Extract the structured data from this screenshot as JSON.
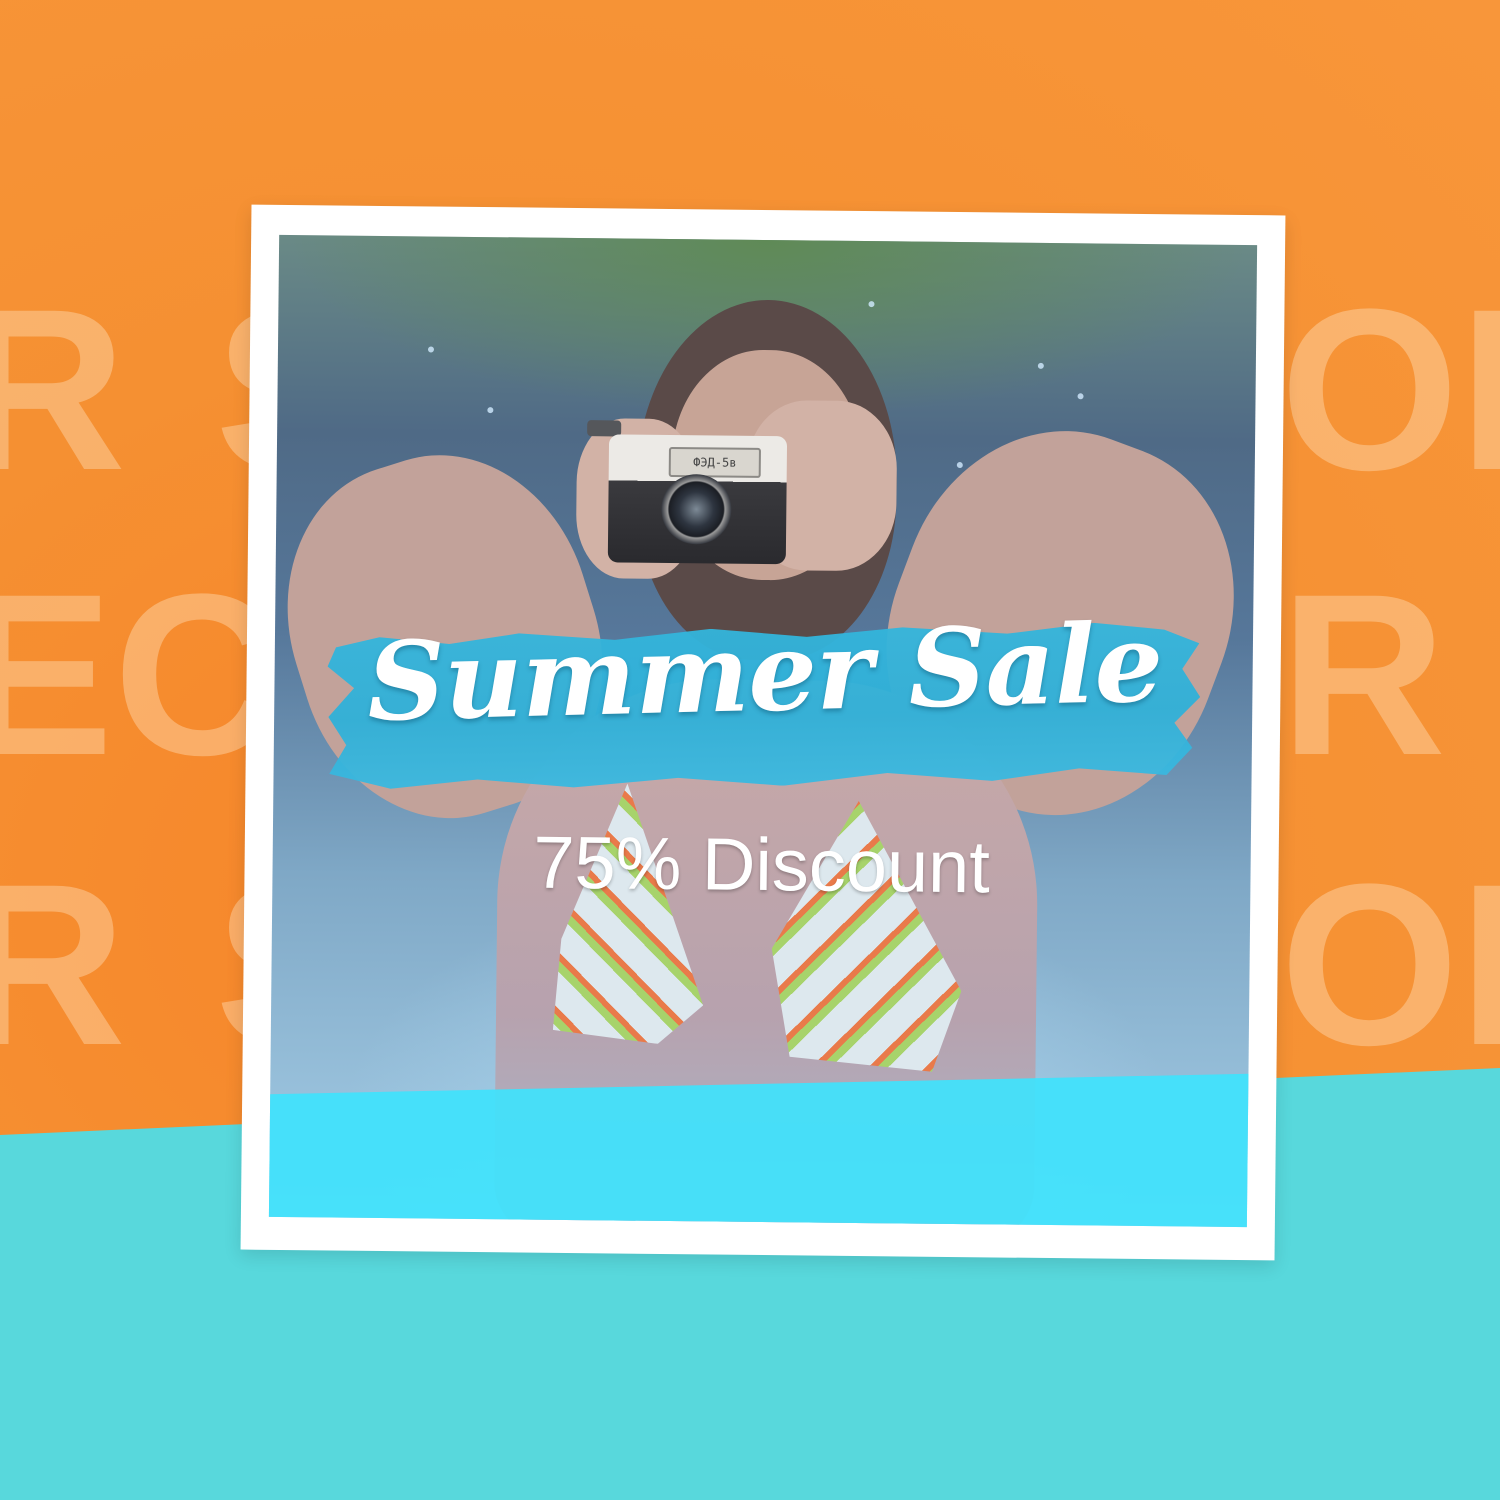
{
  "promo": {
    "headline": "Summer Sale",
    "subline": "75% Discount"
  },
  "background_text": {
    "row1": [
      "R",
      "S",
      "OF"
    ],
    "row2": [
      "EC",
      "R"
    ],
    "row3": [
      "R",
      "S",
      "OF"
    ]
  },
  "camera": {
    "display_text": "ФЭД-5в"
  },
  "colors": {
    "orange_background": "#f59032",
    "teal_band": "#58d8dc",
    "cyan_overlay": "#40e2fc",
    "brush_blue": "#33b5dc",
    "frame_white": "#ffffff",
    "text_white": "#ffffff"
  }
}
